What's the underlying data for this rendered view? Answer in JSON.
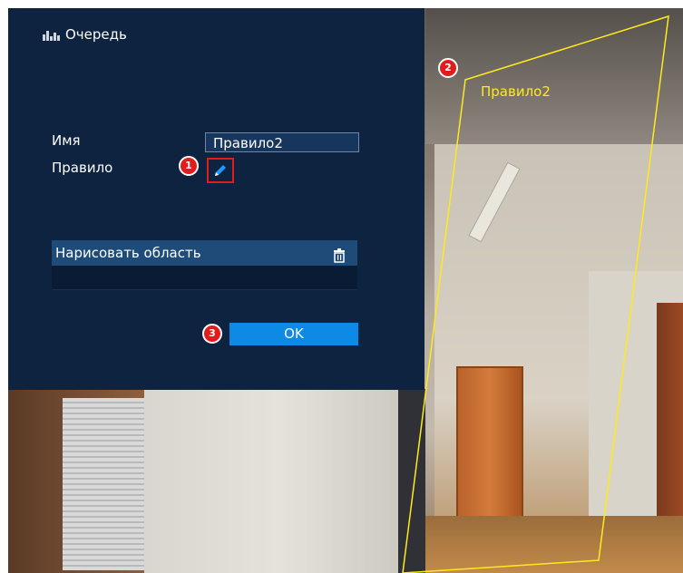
{
  "dialog": {
    "title": "Очередь",
    "name_label": "Имя",
    "name_value": "Правило2",
    "rule_label": "Правило",
    "area_table": {
      "header": "Нарисовать область",
      "rows": [
        "",
        ""
      ]
    },
    "ok_label": "OK"
  },
  "camera": {
    "zone_label": "Правило2",
    "zone_color": "#ffea1a"
  },
  "callouts": [
    "1",
    "2",
    "3"
  ],
  "icons": {
    "title": "queue-icon",
    "edit": "pencil-icon",
    "delete": "trash-icon"
  },
  "colors": {
    "dialog_bg": "#0d2340",
    "accent": "#0c8ae6",
    "highlight": "#e31b1b"
  }
}
